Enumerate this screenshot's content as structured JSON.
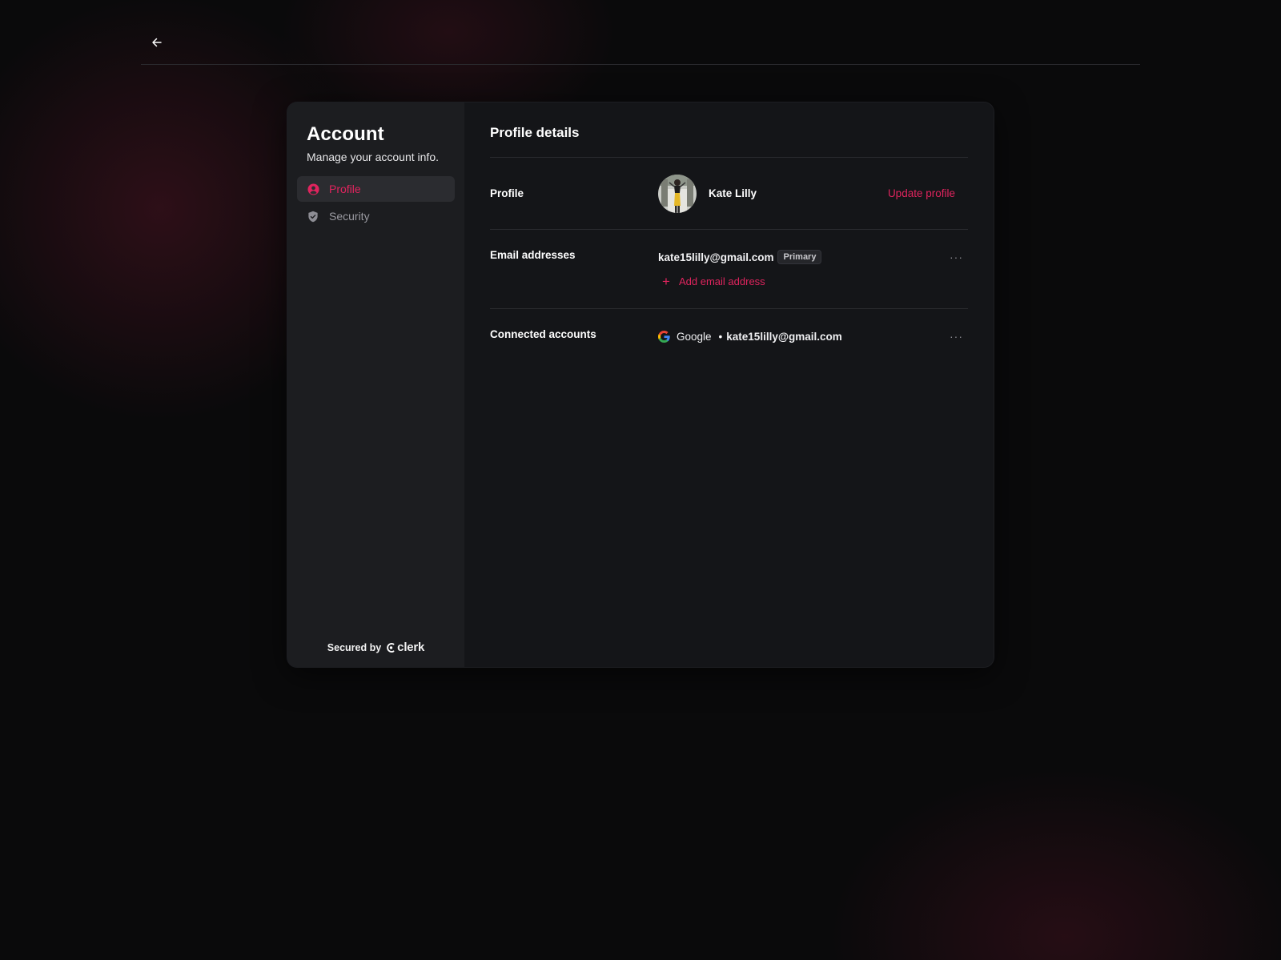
{
  "header": {
    "back_icon": "arrow-left-icon"
  },
  "sidebar": {
    "title": "Account",
    "subtitle": "Manage your account info.",
    "items": [
      {
        "label": "Profile",
        "icon": "user-circle-icon",
        "active": true
      },
      {
        "label": "Security",
        "icon": "shield-check-icon",
        "active": false
      }
    ],
    "footer": {
      "secured_by": "Secured by",
      "brand": "clerk"
    }
  },
  "main": {
    "title": "Profile details",
    "profile": {
      "label": "Profile",
      "name": "Kate Lilly",
      "update_label": "Update profile"
    },
    "emails": {
      "label": "Email addresses",
      "address": "kate15lilly@gmail.com",
      "badge": "Primary",
      "more": "···",
      "add_label": "Add email address",
      "add_icon": "+"
    },
    "connected": {
      "label": "Connected accounts",
      "provider": "Google",
      "separator": "•",
      "email": "kate15lilly@gmail.com",
      "more": "···"
    }
  },
  "colors": {
    "accent": "#e0245e",
    "card_bg": "#141518",
    "sidebar_bg": "#1c1d20",
    "page_bg": "#0a0a0b"
  }
}
